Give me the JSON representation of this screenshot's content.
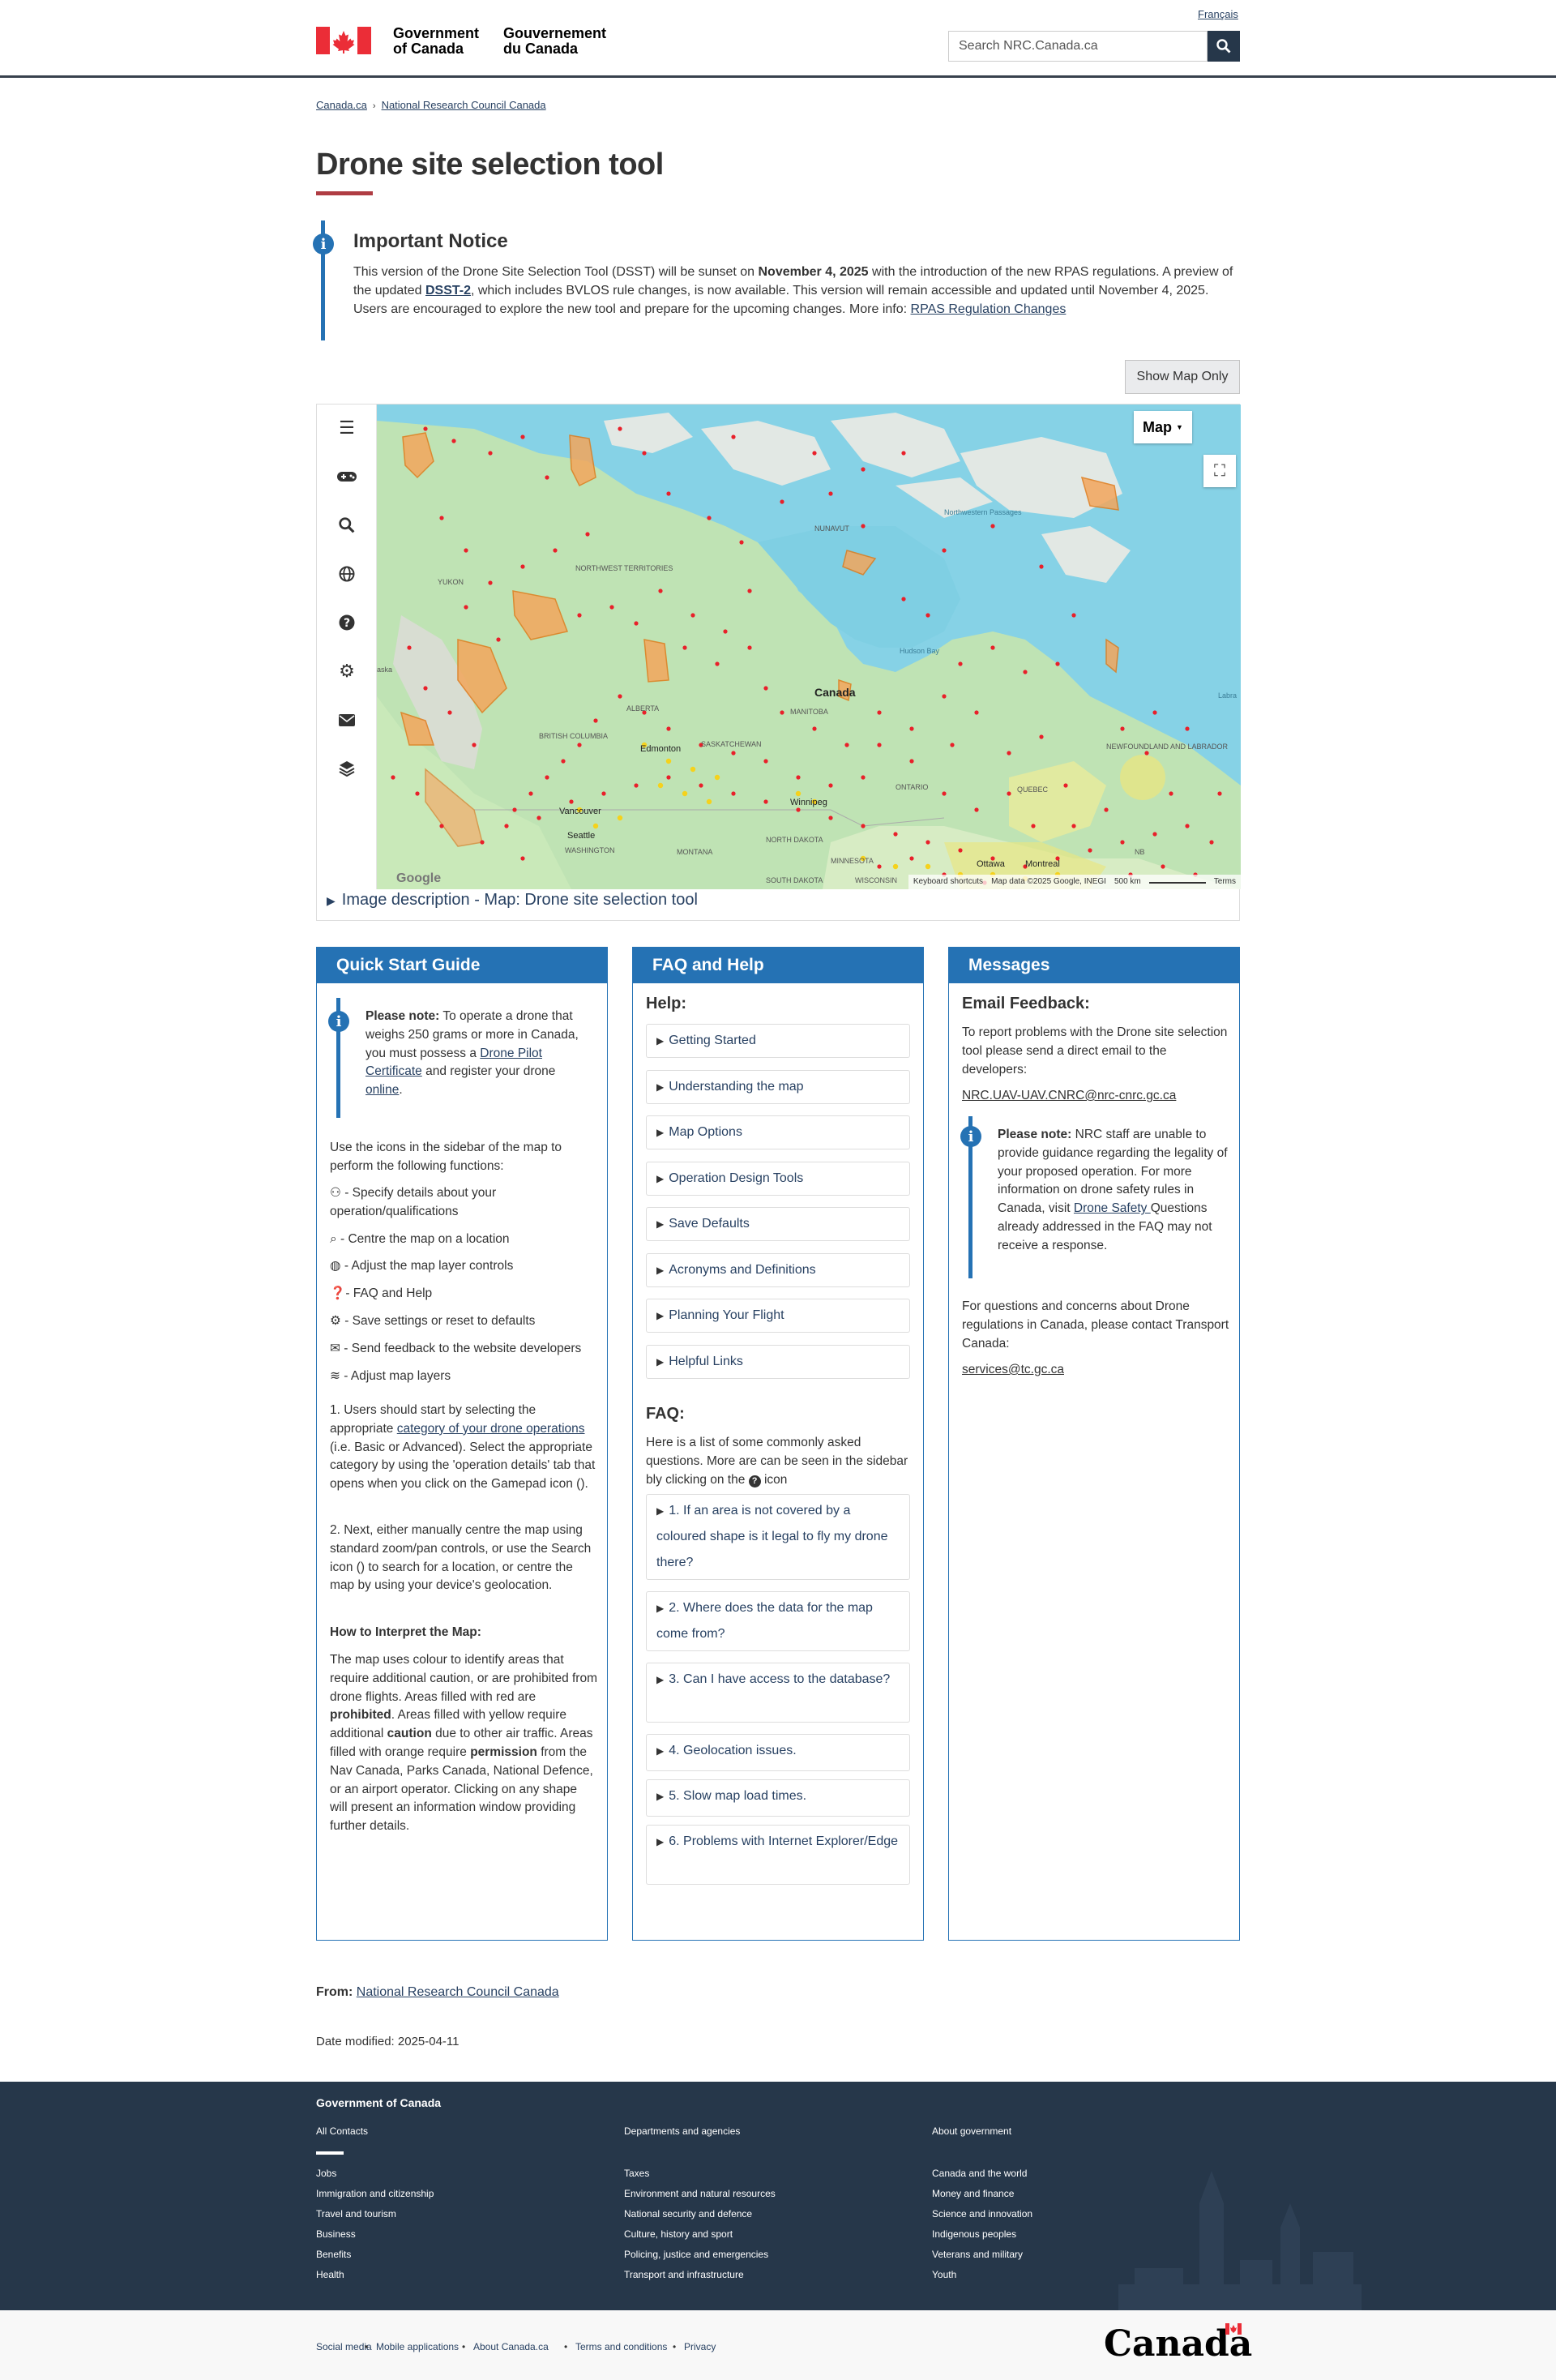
{
  "header": {
    "language_link": "Français",
    "gov_en_line1": "Government",
    "gov_en_line2": "of Canada",
    "gov_fr_line1": "Gouvernement",
    "gov_fr_line2": "du Canada",
    "search_placeholder": "Search NRC.Canada.ca"
  },
  "breadcrumb": [
    "Canada.ca",
    "National Research Council Canada"
  ],
  "page_title": "Drone site selection tool",
  "notice": {
    "heading": "Important Notice",
    "text_1": "This version of the Drone Site Selection Tool (DSST) will be sunset on ",
    "date_bold": "November 4, 2025",
    "text_2": " with the introduction of the new RPAS regulations. A preview of the updated ",
    "link_dsst2": "DSST-2",
    "text_3": ", which includes BVLOS rule changes, is now available. This version will remain accessible and updated until November 4, 2025. Users are encouraged to explore the new tool and prepare for the upcoming changes. More info: ",
    "link_rpas": "RPAS Regulation Changes"
  },
  "show_map_only": "Show Map Only",
  "map": {
    "type_button": "Map",
    "labels": {
      "canada": "Canada",
      "hudson_bay": "Hudson Bay",
      "nunavut": "NUNAVUT",
      "northwest_passages": "Northwestern Passages",
      "nwt": "NORTHWEST TERRITORIES",
      "yukon": "YUKON",
      "alberta": "ALBERTA",
      "bc": "BRITISH COLUMBIA",
      "saskatchewan": "SASKATCHEWAN",
      "manitoba": "MANITOBA",
      "ontario": "ONTARIO",
      "quebec": "QUEBEC",
      "nl": "NEWFOUNDLAND AND LABRADOR",
      "edmonton": "Edmonton",
      "vancouver": "Vancouver",
      "seattle": "Seattle",
      "washington": "WASHINGTON",
      "montana": "MONTANA",
      "north_dakota": "NORTH DAKOTA",
      "south_dakota": "SOUTH DAKOTA",
      "minnesota": "MINNESOTA",
      "wisconsin": "WISCONSIN",
      "winnipeg": "Winnipeg",
      "ottawa": "Ottawa",
      "montreal": "Montreal",
      "alaska": "aska",
      "labrador_sea": "Labra",
      "nb": "NB"
    },
    "attribution": [
      "Keyboard shortcuts",
      "Map data ©2025 Google, INEGI",
      "500 km",
      "Terms"
    ],
    "google": "Google",
    "image_description": "Image description - Map: Drone site selection tool"
  },
  "quick_start": {
    "title": "Quick Start Guide",
    "note_label": "Please note:",
    "note_text_1": " To operate a drone that weighs 250 grams or more in Canada, you must possess a ",
    "note_link_1": "Drone Pilot Certificate",
    "note_text_2": " and register your drone ",
    "note_link_2": "online",
    "note_text_3": ".",
    "intro": "Use the icons in the sidebar of the map to perform the following functions:",
    "functions": [
      "- Specify details about your operation/qualifications",
      "- Centre the map on a location",
      "- Adjust the map layer controls",
      "- FAQ and Help",
      "- Save settings or reset to defaults",
      "- Send feedback to the website developers",
      "- Adjust map layers"
    ],
    "step1_a": "1. Users should start by selecting the appropriate ",
    "step1_link": "category of your drone operations",
    "step1_b": " (i.e. Basic or Advanced). Select the appropriate category by using the 'operation details' tab that opens when you click on the Gamepad icon ().",
    "step2": "2. Next, either manually centre the map using standard zoom/pan controls, or use the Search icon () to search for a location, or centre the map by using your device's geolocation.",
    "interpret_heading": "How to Interpret the Map:",
    "interpret_a": "The map uses colour to identify areas that require additional caution, or are prohibited from drone flights. Areas filled with red are ",
    "prohibited": "prohibited",
    "interpret_b": ". Areas filled with yellow require additional ",
    "caution": "caution",
    "interpret_c": " due to other air traffic. Areas filled with orange require ",
    "permission": "permission",
    "interpret_d": " from the Nav Canada, Parks Canada, National Defence, or an airport operator. Clicking on any shape will present an information window providing further details."
  },
  "faq": {
    "title": "FAQ and Help",
    "help_heading": "Help:",
    "help_items": [
      "Getting Started",
      "Understanding the map",
      "Map Options",
      "Operation Design Tools",
      "Save Defaults",
      "Acronyms and Definitions",
      "Planning Your Flight",
      "Helpful Links"
    ],
    "faq_heading": "FAQ:",
    "faq_intro": "Here is a list of some commonly asked questions. More are can be seen in the sidebar bly clicking on the",
    "faq_intro_end": " icon",
    "faq_items": [
      "1. If an area is not covered by a coloured shape is it legal to fly my drone there?",
      "2. Where does the data for the map come from?",
      "3. Can I have access to the database?",
      "4. Geolocation issues.",
      "5. Slow map load times.",
      "6. Problems with Internet Explorer/Edge"
    ]
  },
  "messages": {
    "title": "Messages",
    "email_heading": "Email Feedback:",
    "email_intro": "To report problems with the Drone site selection tool please send a direct email to the developers:",
    "email_link": "NRC.UAV-UAV.CNRC@nrc-cnrc.gc.ca",
    "note_label": "Please note:",
    "note_text_1": " NRC staff are unable to provide guidance regarding the legality of your proposed operation. For more information on drone safety rules in Canada, visit ",
    "note_link": "Drone Safety ",
    "note_text_2": "Questions already addressed in the FAQ may not receive a response.",
    "tc_text": "For questions and concerns about Drone regulations in Canada, please contact Transport Canada:",
    "tc_link": "services@tc.gc.ca"
  },
  "from_label": "From:",
  "from_link": "National Research Council Canada",
  "date_modified": "Date modified: 2025-04-11",
  "footer": {
    "title": "Government of Canada",
    "all_contacts": "All Contacts",
    "col1": [
      "Jobs",
      "Immigration and citizenship",
      "Travel and tourism",
      "Business",
      "Benefits",
      "Health"
    ],
    "col2_heading": "Departments and agencies",
    "col2": [
      "Taxes",
      "Environment and natural resources",
      "National security and defence",
      "Culture, history and sport",
      "Policing, justice and emergencies",
      "Transport and infrastructure"
    ],
    "col3_heading": "About government",
    "col3": [
      "Canada and the world",
      "Money and finance",
      "Science and innovation",
      "Indigenous peoples",
      "Veterans and military",
      "Youth"
    ],
    "bottom_links": [
      "Social media",
      "Mobile applications",
      "About Canada.ca",
      "Terms and conditions",
      "Privacy"
    ],
    "wordmark": "Canada"
  },
  "colors": {
    "brand_blue": "#2572b4",
    "header_dark": "#26374a",
    "title_underline": "#af3c43",
    "link": "#284162"
  }
}
